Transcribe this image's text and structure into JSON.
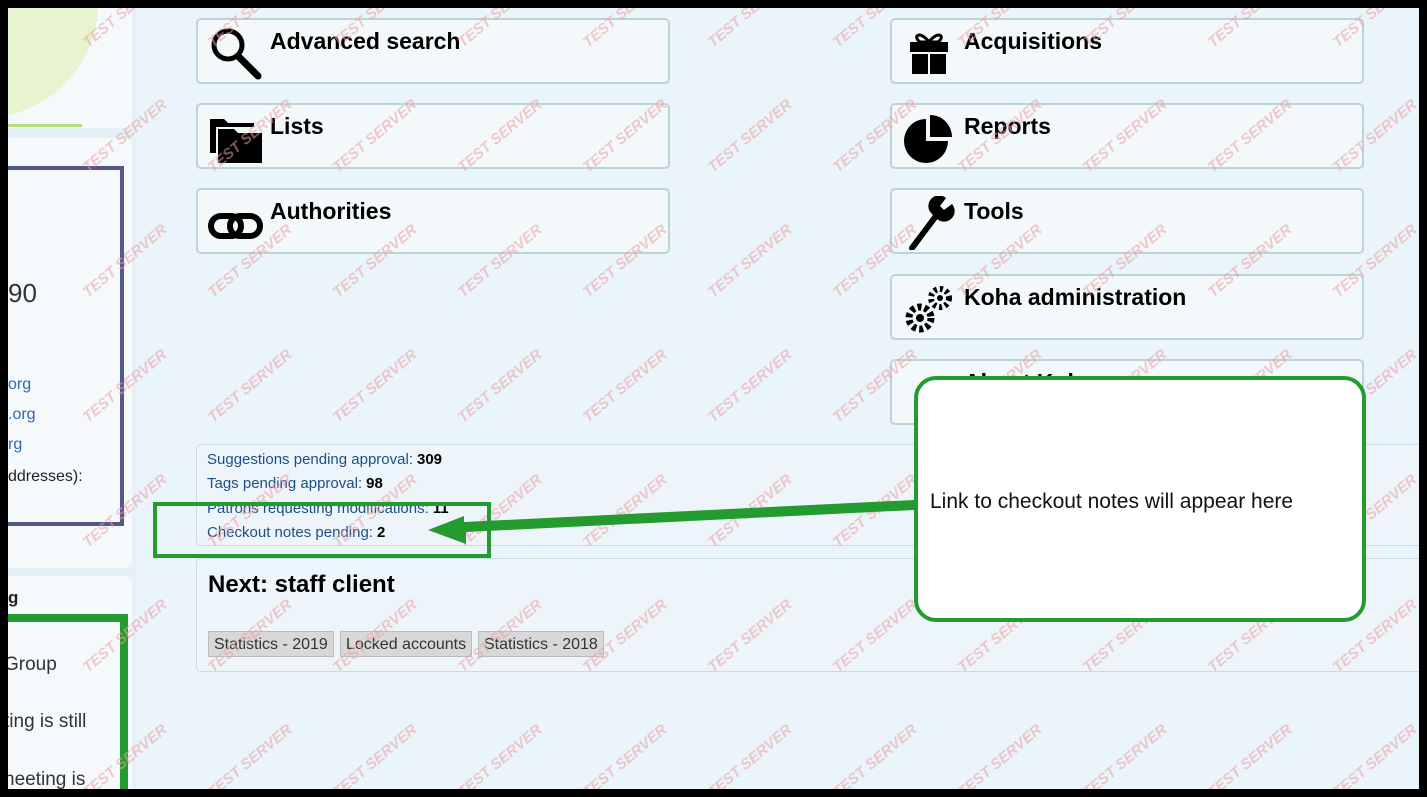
{
  "nav_left": [
    {
      "label": "Advanced search",
      "icon": "magnifier-icon"
    },
    {
      "label": "Lists",
      "icon": "folders-icon"
    },
    {
      "label": "Authorities",
      "icon": "chain-link-icon"
    }
  ],
  "nav_right": [
    {
      "label": "Acquisitions",
      "icon": "gift-icon"
    },
    {
      "label": "Reports",
      "icon": "pie-chart-icon"
    },
    {
      "label": "Tools",
      "icon": "wrench-icon"
    },
    {
      "label": "Koha administration",
      "icon": "gears-icon"
    },
    {
      "label": "About Koha",
      "icon": "koha-logo-icon"
    }
  ],
  "pending": [
    {
      "label": "Suggestions pending approval:",
      "count": "309"
    },
    {
      "label": "Tags pending approval:",
      "count": "98"
    },
    {
      "label": "Patrons requesting modifications:",
      "count": "11"
    },
    {
      "label": "Checkout notes pending:",
      "count": "2"
    }
  ],
  "news": {
    "title": "Next: staff client",
    "tabs": [
      "Statistics - 2019",
      "Locked accounts",
      "Statistics - 2018"
    ]
  },
  "left_sidebar": {
    "number": "90",
    "links": [
      "org",
      ".org",
      "rg"
    ],
    "addresses_text": "ddresses):",
    "heading": "g",
    "body_lines": [
      "Group",
      "ting is still",
      "neeting is"
    ]
  },
  "watermark": "TEST SERVER",
  "annotation": {
    "callout_text": "Link to checkout notes will appear here"
  },
  "colors": {
    "annotation_green": "#239b2f",
    "link_blue": "#1c4f86",
    "watermark_red": "#e9a0a0",
    "page_bg": "#eaf4fb"
  }
}
